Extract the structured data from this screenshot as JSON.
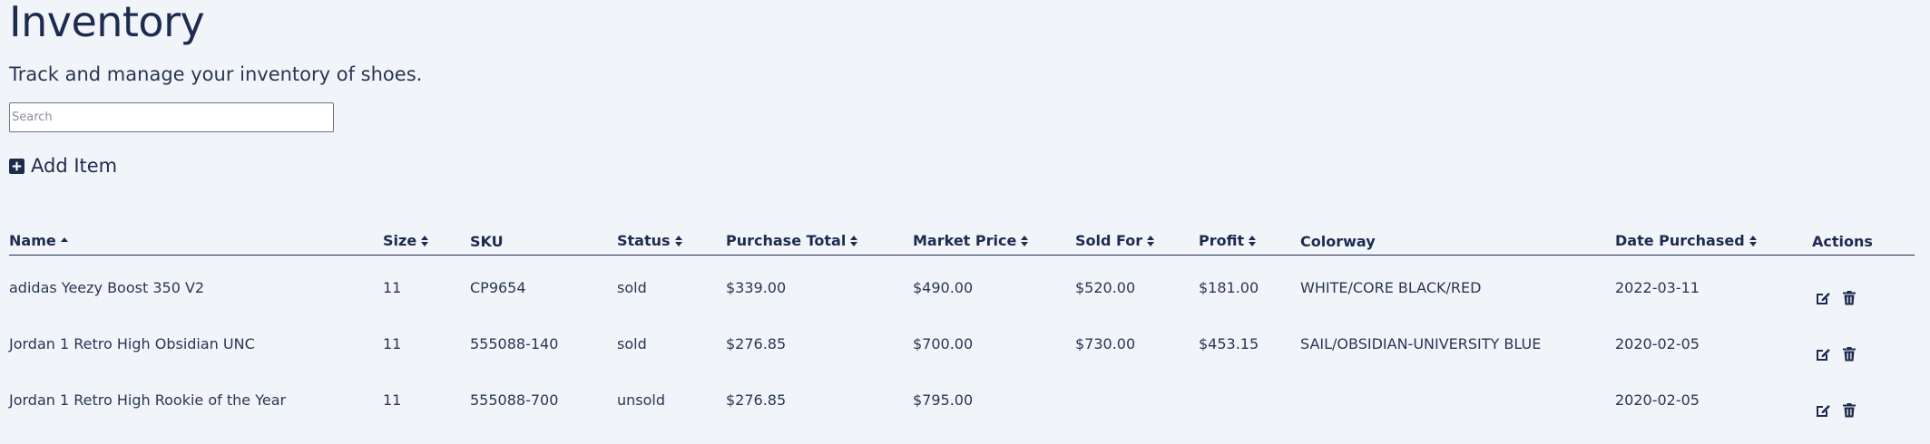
{
  "page": {
    "title": "Inventory",
    "subtitle": "Track and manage your inventory of shoes."
  },
  "search": {
    "placeholder": "Search",
    "value": ""
  },
  "add_item": {
    "label": "Add Item",
    "icon": "plus-square-icon"
  },
  "table": {
    "columns": [
      {
        "label": "Name",
        "sort": "asc"
      },
      {
        "label": "Size",
        "sort": "both"
      },
      {
        "label": "SKU",
        "sort": "none"
      },
      {
        "label": "Status",
        "sort": "both"
      },
      {
        "label": "Purchase Total",
        "sort": "both"
      },
      {
        "label": "Market Price",
        "sort": "both"
      },
      {
        "label": "Sold For",
        "sort": "both"
      },
      {
        "label": "Profit",
        "sort": "both"
      },
      {
        "label": "Colorway",
        "sort": "none"
      },
      {
        "label": "Date Purchased",
        "sort": "both"
      },
      {
        "label": "Actions",
        "sort": "none"
      }
    ],
    "rows": [
      {
        "name": "adidas Yeezy Boost 350 V2",
        "size": "11",
        "sku": "CP9654",
        "status": "sold",
        "purchase_total": "$339.00",
        "market_price": "$490.00",
        "sold_for": "$520.00",
        "profit": "$181.00",
        "colorway": "WHITE/CORE BLACK/RED",
        "date_purchased": "2022-03-11"
      },
      {
        "name": "Jordan 1 Retro High Obsidian UNC",
        "size": "11",
        "sku": "555088-140",
        "status": "sold",
        "purchase_total": "$276.85",
        "market_price": "$700.00",
        "sold_for": "$730.00",
        "profit": "$453.15",
        "colorway": "SAIL/OBSIDIAN-UNIVERSITY BLUE",
        "date_purchased": "2020-02-05"
      },
      {
        "name": "Jordan 1 Retro High Rookie of the Year",
        "size": "11",
        "sku": "555088-700",
        "status": "unsold",
        "purchase_total": "$276.85",
        "market_price": "$795.00",
        "sold_for": "",
        "profit": "",
        "colorway": "",
        "date_purchased": "2020-02-05"
      }
    ],
    "action_icons": [
      "edit-icon",
      "trash-icon"
    ]
  },
  "colors": {
    "background": "#f1f5fa",
    "primary": "#1d2b4f",
    "text": "#2a3553"
  }
}
